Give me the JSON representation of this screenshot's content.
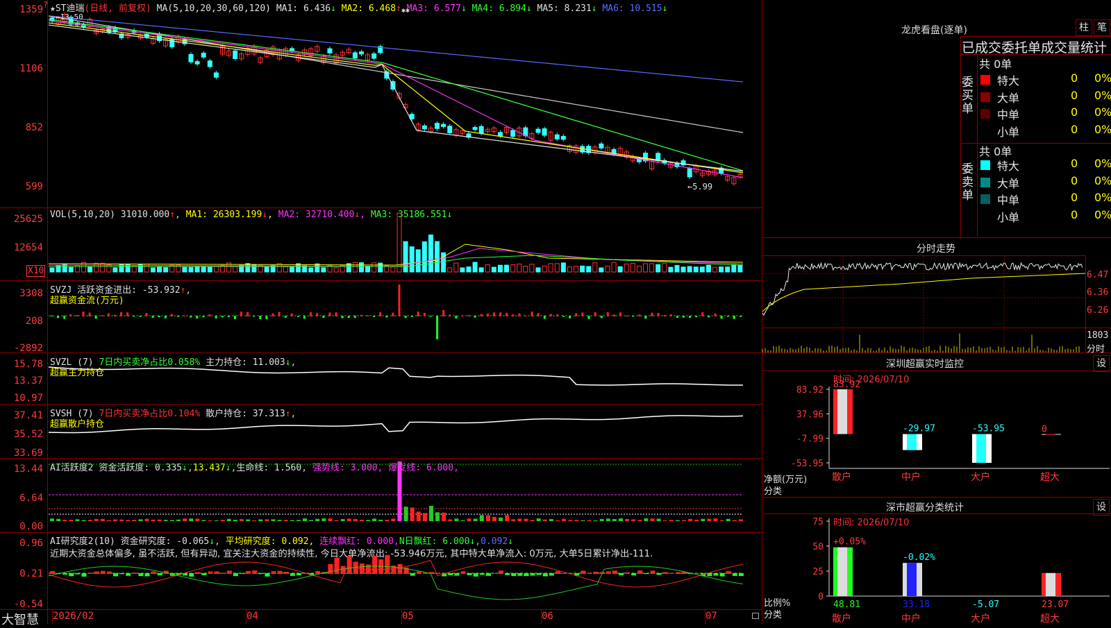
{
  "main_chart": {
    "title": "★ST迪瑞",
    "title_note": "(日线, 前复权)",
    "ma_label": "MA(5,10,20,30,60,120)",
    "ma": [
      {
        "name": "MA1",
        "value": "6.436",
        "arrow": "↓",
        "color": "#e0e0e0"
      },
      {
        "name": "MA2",
        "value": "6.468",
        "arrow": "↑",
        "color": "#ffff00"
      },
      {
        "name": "MA3",
        "value": "6.577",
        "arrow": "↓",
        "color": "#ff33ff"
      },
      {
        "name": "MA4",
        "value": "6.894",
        "arrow": "↓",
        "color": "#33ff33"
      },
      {
        "name": "MA5",
        "value": "8.231",
        "arrow": "↓",
        "color": "#e0e0e0"
      },
      {
        "name": "MA6",
        "value": "10.515",
        "arrow": "↓",
        "color": "#5a6bff"
      }
    ],
    "y_ticks": [
      "1359",
      "1106",
      "852",
      "599"
    ],
    "high_mark": "←13.50",
    "low_mark": "←5.99"
  },
  "vol_panel": {
    "label": "VOL(5,10,20)",
    "value": "31010.000",
    "ma1": "26303.199",
    "ma2": "32710.400",
    "ma3": "35186.551",
    "y_ticks": [
      "25625",
      "12654"
    ],
    "unit": "X10"
  },
  "svzj_panel": {
    "label": "SVZJ",
    "desc": "活跃资金进出:",
    "value": "-53.932",
    "sub": "超赢资金流(万元)",
    "y_ticks": [
      "3308",
      "208",
      "-2892"
    ]
  },
  "svzl_panel": {
    "label": "SVZL (7)",
    "desc": "7日内买卖净占比0.058%",
    "hold_label": "主力持仓:",
    "hold_value": "11.003",
    "sub": "超赢主力持仓",
    "y_ticks": [
      "15.78",
      "13.37",
      "10.97"
    ]
  },
  "svsh_panel": {
    "label": "SVSH (7)",
    "desc": "7日内买卖净占比0.104%",
    "hold_label": "散户持仓:",
    "hold_value": "37.313",
    "sub": "超赢散户持仓",
    "y_ticks": [
      "37.41",
      "35.52",
      "33.69"
    ]
  },
  "ai_active_panel": {
    "label": "AI活跃度2",
    "a_label": "资金活跃度:",
    "a_value": "0.335",
    "b_value": "13.437",
    "life_label": "生命线:",
    "life_value": "1.560",
    "strong_label": "强势线:",
    "strong_value": "3.000",
    "burst_label": "爆发线:",
    "burst_value": "6.000",
    "y_ticks": [
      "13.44",
      "6.64",
      "0.00"
    ]
  },
  "ai_research_panel": {
    "label": "AI研究度2(10)",
    "r_label": "资金研究度:",
    "r_value": "-0.065",
    "avg_label": "平均研究度:",
    "avg_value": "0.092",
    "cont_label": "连续飘红:",
    "cont_value": "0.000",
    "n_label": "N日飘红:",
    "n_value": "6.000",
    "last_value": "0.092",
    "comment": "近期大资金总体偏多, 虽不活跃, 但有异动, 宜关注大资金的持续性, 今日大单净流出: -53.946万元, 其中特大单净流入: 0万元, 大单5日累计净出-111.",
    "y_ticks": [
      "0.96",
      "0.21",
      "-0.54"
    ]
  },
  "x_axis": {
    "dates": [
      "2026/02",
      "04",
      "05",
      "06",
      "07"
    ],
    "brand": "大智慧"
  },
  "dragon_tiger": {
    "title": "龙虎看盘(逐单)",
    "btn_pillar": "柱",
    "btn_pen": "笔",
    "subtitle": "已成交委托单成交量统计",
    "buy_side": "委买单",
    "sell_side": "委卖单",
    "buy_total": "共 0单",
    "sell_total": "共 0单",
    "buy_rows": [
      {
        "label": "特大",
        "count": "0",
        "pct": "0%",
        "color": "#ff0000"
      },
      {
        "label": "大单",
        "count": "0",
        "pct": "0%",
        "color": "#8b0000"
      },
      {
        "label": "中单",
        "count": "0",
        "pct": "0%",
        "color": "#5a0000"
      },
      {
        "label": "小单",
        "count": "0",
        "pct": "0%",
        "color": "#000000"
      }
    ],
    "sell_rows": [
      {
        "label": "特大",
        "count": "0",
        "pct": "0%",
        "color": "#00ffff"
      },
      {
        "label": "大单",
        "count": "0",
        "pct": "0%",
        "color": "#008b8b"
      },
      {
        "label": "中单",
        "count": "0",
        "pct": "0%",
        "color": "#006060"
      },
      {
        "label": "小单",
        "count": "0",
        "pct": "0%",
        "color": "#000000"
      }
    ]
  },
  "intraday": {
    "title": "分时走势",
    "y_ticks": [
      "6.47",
      "6.36",
      "6.26"
    ],
    "vol_tick": "1803",
    "vol_label": "分时"
  },
  "sz_monitor": {
    "title": "深圳超赢实时监控",
    "btn": "设",
    "time_label": "时间: 2026/07/10",
    "y_ticks": [
      "83.92",
      "37.96",
      "-7.99",
      "-53.95"
    ],
    "y_axis_label": "净额(万元)",
    "x_axis_label": "分类",
    "categories": [
      "散户",
      "中户",
      "大户",
      "超大"
    ],
    "values": [
      83.92,
      -29.97,
      -53.95,
      0
    ],
    "value_labels": [
      "83.92",
      "-29.97",
      "-53.95",
      "0"
    ]
  },
  "sz_class": {
    "title": "深市超赢分类统计",
    "btn": "设",
    "time_label": "时间: 2026/07/10",
    "y_ticks": [
      "75",
      "50",
      "25",
      "0"
    ],
    "y_axis_label": "比例%",
    "x_axis_label": "分类",
    "categories": [
      "散户",
      "中户",
      "大户",
      "超大"
    ],
    "values": [
      48.81,
      33.18,
      -5.07,
      23.07
    ],
    "value_labels": [
      "48.81",
      "33.18",
      "-5.07",
      "23.07"
    ],
    "change_labels": [
      "+0.05%",
      "-0.02%",
      "",
      ""
    ]
  },
  "chart_data": [
    {
      "type": "bar",
      "title": "深圳超赢实时监控",
      "categories": [
        "散户",
        "中户",
        "大户",
        "超大"
      ],
      "values": [
        83.92,
        -29.97,
        -53.95,
        0
      ],
      "ylabel": "净额(万元)",
      "xlabel": "分类",
      "ylim": [
        -53.95,
        83.92
      ]
    },
    {
      "type": "bar",
      "title": "深市超赢分类统计",
      "categories": [
        "散户",
        "中户",
        "大户",
        "超大"
      ],
      "values": [
        48.81,
        33.18,
        -5.07,
        23.07
      ],
      "ylabel": "比例%",
      "xlabel": "分类",
      "ylim": [
        0,
        75
      ]
    }
  ]
}
